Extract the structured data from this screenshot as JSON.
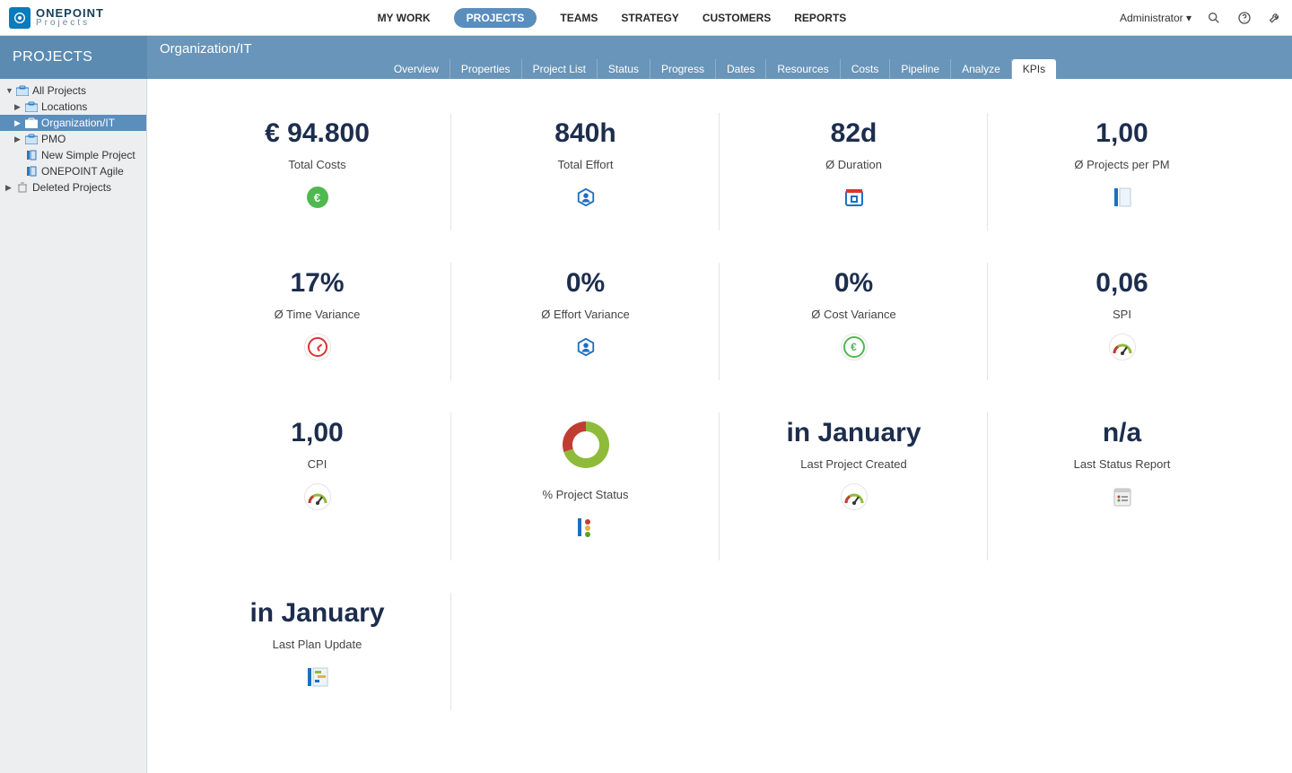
{
  "brand": {
    "line1": "ONEPOINT",
    "line2": "Projects"
  },
  "nav": {
    "items": [
      {
        "label": "MY WORK",
        "active": false
      },
      {
        "label": "PROJECTS",
        "active": true
      },
      {
        "label": "TEAMS",
        "active": false
      },
      {
        "label": "STRATEGY",
        "active": false
      },
      {
        "label": "CUSTOMERS",
        "active": false
      },
      {
        "label": "REPORTS",
        "active": false
      }
    ]
  },
  "topright": {
    "user_label": "Administrator ▾"
  },
  "page": {
    "section_title": "PROJECTS",
    "breadcrumb": "Organization/IT",
    "tabs": [
      "Overview",
      "Properties",
      "Project List",
      "Status",
      "Progress",
      "Dates",
      "Resources",
      "Costs",
      "Pipeline",
      "Analyze",
      "KPIs"
    ],
    "active_tab": "KPIs"
  },
  "tree": [
    {
      "label": "All Projects",
      "depth": 0,
      "expanded": true,
      "icon": "portfolio",
      "selected": false
    },
    {
      "label": "Locations",
      "depth": 1,
      "expanded": false,
      "icon": "portfolio",
      "selected": false
    },
    {
      "label": "Organization/IT",
      "depth": 1,
      "expanded": false,
      "icon": "portfolio",
      "selected": true
    },
    {
      "label": "PMO",
      "depth": 1,
      "expanded": false,
      "icon": "portfolio",
      "selected": false
    },
    {
      "label": "New Simple Project",
      "depth": 1,
      "expanded": null,
      "icon": "project",
      "selected": false
    },
    {
      "label": "ONEPOINT Agile",
      "depth": 1,
      "expanded": null,
      "icon": "project",
      "selected": false
    },
    {
      "label": "Deleted Projects",
      "depth": 0,
      "expanded": false,
      "icon": "trash",
      "selected": false
    }
  ],
  "kpis": [
    {
      "value": "€ 94.800",
      "label": "Total Costs",
      "icon": "euro-solid"
    },
    {
      "value": "840h",
      "label": "Total Effort",
      "icon": "person-hex"
    },
    {
      "value": "82d",
      "label": "Ø Duration",
      "icon": "calendar"
    },
    {
      "value": "1,00",
      "label": "Ø Projects per PM",
      "icon": "list-blue"
    },
    {
      "value": "17%",
      "label": "Ø Time Variance",
      "icon": "clock-red"
    },
    {
      "value": "0%",
      "label": "Ø Effort Variance",
      "icon": "person-hex"
    },
    {
      "value": "0%",
      "label": "Ø Cost Variance",
      "icon": "euro-outline"
    },
    {
      "value": "0,06",
      "label": "SPI",
      "icon": "gauge"
    },
    {
      "value": "1,00",
      "label": "CPI",
      "icon": "gauge-euro"
    },
    {
      "value": "",
      "label": "% Project Status",
      "icon": "status-lights",
      "chart": "donut"
    },
    {
      "value": "in January",
      "label": "Last Project Created",
      "icon": "gauge-small"
    },
    {
      "value": "n/a",
      "label": "Last Status Report",
      "icon": "report"
    },
    {
      "value": "in January",
      "label": "Last Plan Update",
      "icon": "plan"
    }
  ],
  "chart_data": {
    "type": "pie",
    "title": "% Project Status",
    "series": [
      {
        "name": "Green",
        "value": 70,
        "color": "#8fbb3a"
      },
      {
        "name": "Red",
        "value": 30,
        "color": "#c13d33"
      }
    ]
  }
}
